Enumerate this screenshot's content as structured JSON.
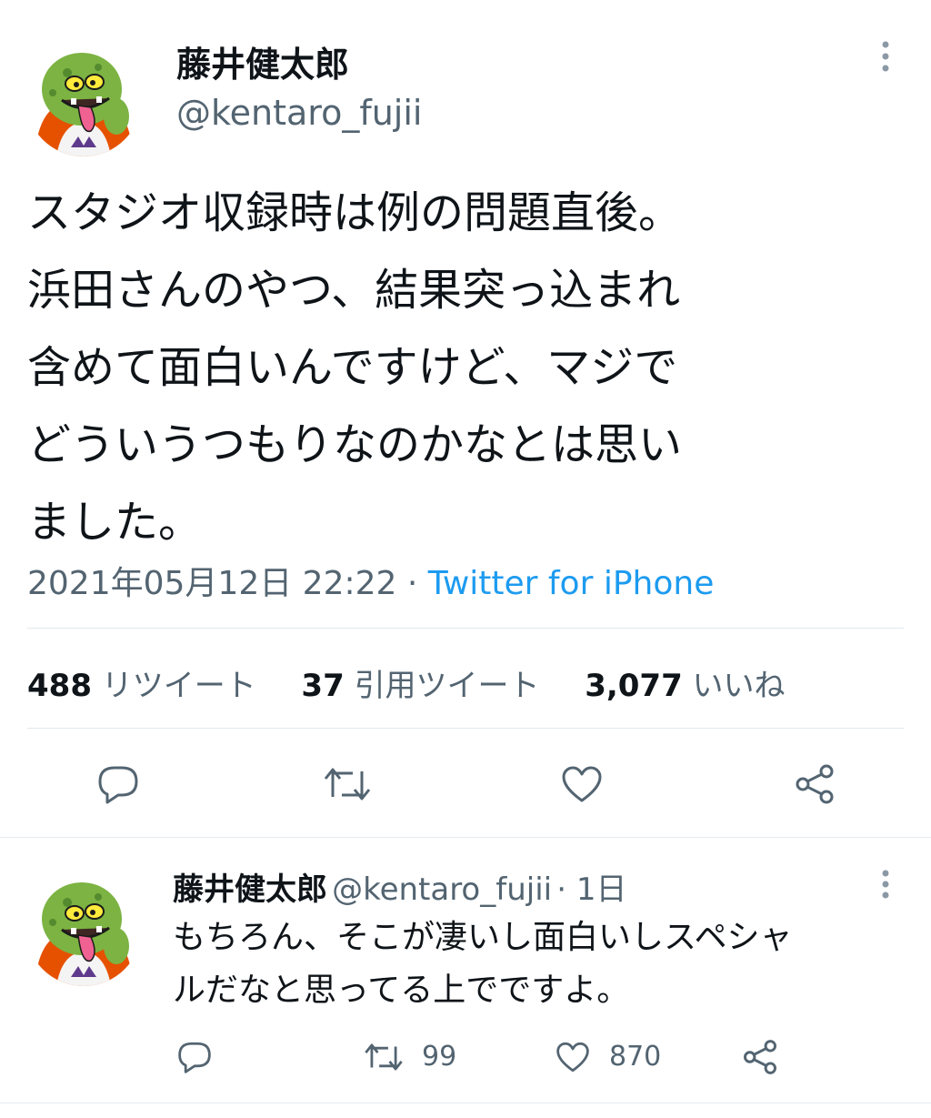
{
  "tweet": {
    "author_name": "藤井健太郎",
    "author_handle": "@kentaro_fujii",
    "text_lines": [
      "スタジオ収録時は例の問題直後。",
      "浜田さんのやつ、結果突っ込まれ",
      "含めて面白いんですけど、マジで",
      "どういうつもりなのかなとは思い",
      "ました。"
    ],
    "timestamp": "2021年05月12日 22:22",
    "separator": " · ",
    "source": "Twitter for iPhone",
    "retweets": "488",
    "retweets_label": "リツイート",
    "quotes": "37",
    "quotes_label": "引用ツイート",
    "likes": "3,077",
    "likes_label": "いいね",
    "action_icons": [
      "reply-icon",
      "retweet-icon",
      "like-icon",
      "share-icon"
    ]
  },
  "reply": {
    "author_name": "藤井健太郎",
    "author_handle": "@kentaro_fujii",
    "time": "· 1日",
    "text_lines": [
      "もちろん、そこが凄いし面白いしスペシャ",
      "ルだなと思ってる上でですよ。"
    ],
    "retweet_count": "99",
    "like_count": "870"
  },
  "colors": {
    "text": "#0f1419",
    "secondary": "#536471",
    "link": "#1d9bf0",
    "divider": "#e1e8ed",
    "avatar_skin": "#7cb342",
    "avatar_shirt": "#e65100"
  }
}
